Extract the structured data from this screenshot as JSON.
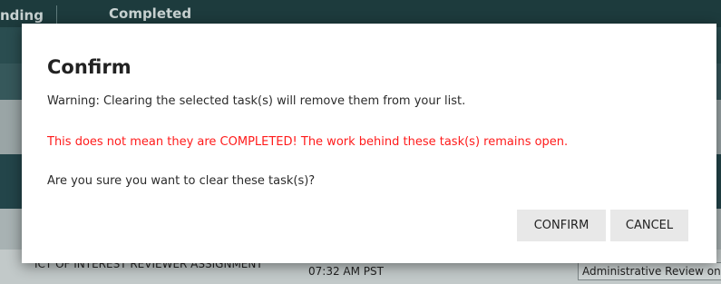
{
  "background": {
    "tabs": {
      "pending": "nding",
      "completed": "Completed"
    },
    "row": {
      "title": "ICT OF INTEREST REVIEWER ASSIGNMENT",
      "time": "07:32 AM PST",
      "status": "Administrative Review on"
    }
  },
  "dialog": {
    "title": "Confirm",
    "warning": "Warning: Clearing the selected task(s) will remove them from your list.",
    "alert": "This does not mean they are COMPLETED! The work behind these task(s) remains open.",
    "question": "Are you sure you want to clear these task(s)?",
    "confirm_label": "CONFIRM",
    "cancel_label": "CANCEL"
  },
  "colors": {
    "alert": "#ff1b1b",
    "overlay": "#1d3b3d",
    "button": "#e8e8e8"
  }
}
